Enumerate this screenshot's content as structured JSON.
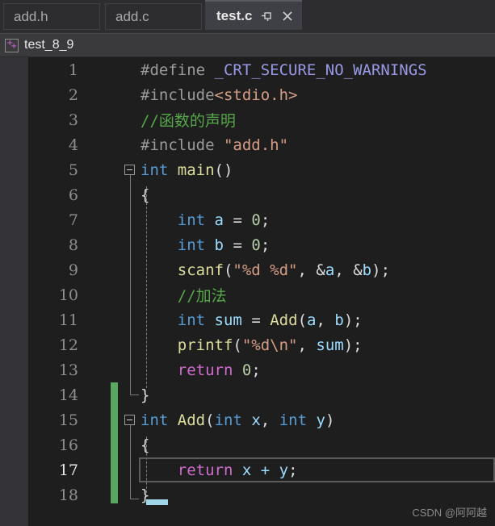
{
  "tabs": [
    {
      "label": "add.h",
      "active": false
    },
    {
      "label": "add.c",
      "active": false
    },
    {
      "label": "test.c",
      "active": true
    }
  ],
  "tab_icons": {
    "pin": "pin-icon",
    "close": "close-icon"
  },
  "breadcrumb": {
    "icon": "cpp-project-icon",
    "label": "test_8_9"
  },
  "editor": {
    "language": "c",
    "current_line": 17,
    "lines": [
      {
        "n": "1",
        "text": "#define _CRT_SECURE_NO_WARNINGS"
      },
      {
        "n": "2",
        "text": "#include<stdio.h>"
      },
      {
        "n": "3",
        "text": "//函数的声明"
      },
      {
        "n": "4",
        "text": "#include \"add.h\""
      },
      {
        "n": "5",
        "text": "int main()"
      },
      {
        "n": "6",
        "text": "{"
      },
      {
        "n": "7",
        "text": "    int a = 0;"
      },
      {
        "n": "8",
        "text": "    int b = 0;"
      },
      {
        "n": "9",
        "text": "    scanf(\"%d %d\", &a, &b);"
      },
      {
        "n": "10",
        "text": "    //加法"
      },
      {
        "n": "11",
        "text": "    int sum = Add(a, b);"
      },
      {
        "n": "12",
        "text": "    printf(\"%d\\n\", sum);"
      },
      {
        "n": "13",
        "text": "    return 0;"
      },
      {
        "n": "14",
        "text": "}"
      },
      {
        "n": "15",
        "text": "int Add(int x, int y)"
      },
      {
        "n": "16",
        "text": "{"
      },
      {
        "n": "17",
        "text": "    return x + y;"
      },
      {
        "n": "18",
        "text": "}"
      }
    ]
  },
  "watermark": "CSDN @阿阿越",
  "colors": {
    "editor_bg": "#1e1e1e",
    "tabbar_bg": "#2d2d30",
    "active_tab_bg": "#3f3f46",
    "navbar_bg": "#3a3a3d",
    "margin_bg": "#333337",
    "change_bar": "#5aa860",
    "keyword": "#569cd6",
    "comment": "#57a64a",
    "string": "#d69d85",
    "function": "#dcdc9d",
    "variable": "#9cdcfe",
    "number": "#b5cea8",
    "return_keyword": "#d06bd0",
    "macro": "#9999e6",
    "line_number": "#8f8f8f"
  }
}
